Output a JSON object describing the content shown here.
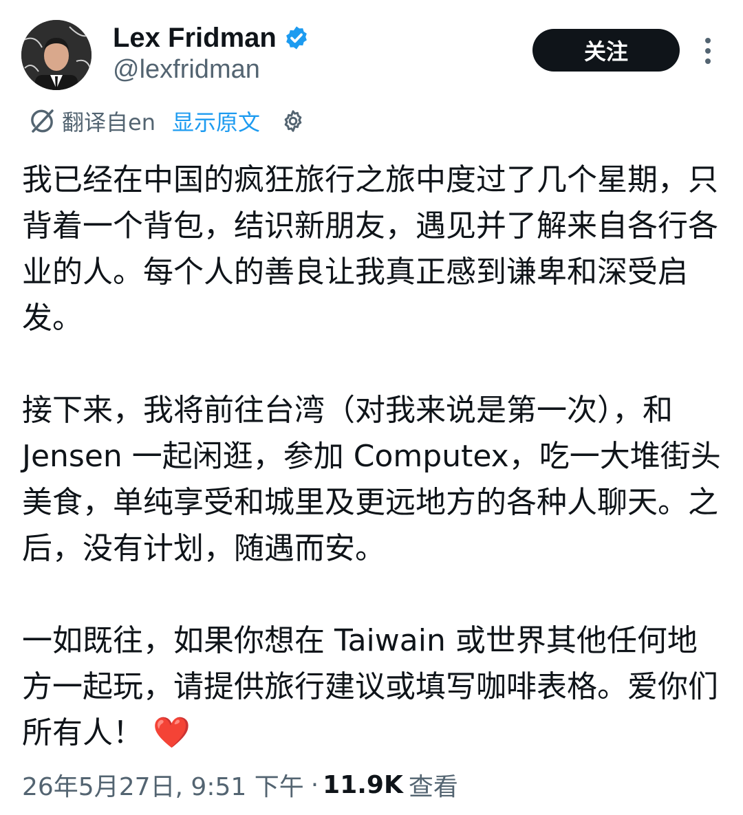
{
  "author": {
    "name": "Lex Fridman",
    "handle": "@lexfridman",
    "verified": true
  },
  "follow_button": {
    "label": "关注"
  },
  "translation": {
    "translated_from": "翻译自en",
    "show_original": "显示原文"
  },
  "tweet": {
    "text": "我已经在中国的疯狂旅行之旅中度过了几个星期，只背着一个背包，结识新朋友，遇见并了解来自各行各业的人。每个人的善良让我真正感到谦卑和深受启发。\n\n接下来，我将前往台湾（对我来说是第一次），和 Jensen 一起闲逛，参加 Computex，吃一大堆街头美食，单纯享受和城里及更远地方的各种人聊天。之后，没有计划，随遇而安。\n\n一如既往，如果你想在 Taiwain 或世界其他任何地方一起玩，请提供旅行建议或填写咖啡表格。爱你们所有人！",
    "emoji": "❤️"
  },
  "meta": {
    "timestamp": "26年5月27日, 9:51 下午",
    "separator": "·",
    "views_count": "11.9K",
    "views_label": "查看"
  },
  "colors": {
    "accent": "#1d9bf0",
    "text_primary": "#0f1419",
    "text_secondary": "#536471",
    "button_bg": "#0f1419",
    "heart": "#e0245e"
  },
  "icons": {
    "verified": "verified-badge-icon",
    "more": "more-vertical-icon",
    "translate": "translate-icon",
    "settings": "gear-icon"
  }
}
